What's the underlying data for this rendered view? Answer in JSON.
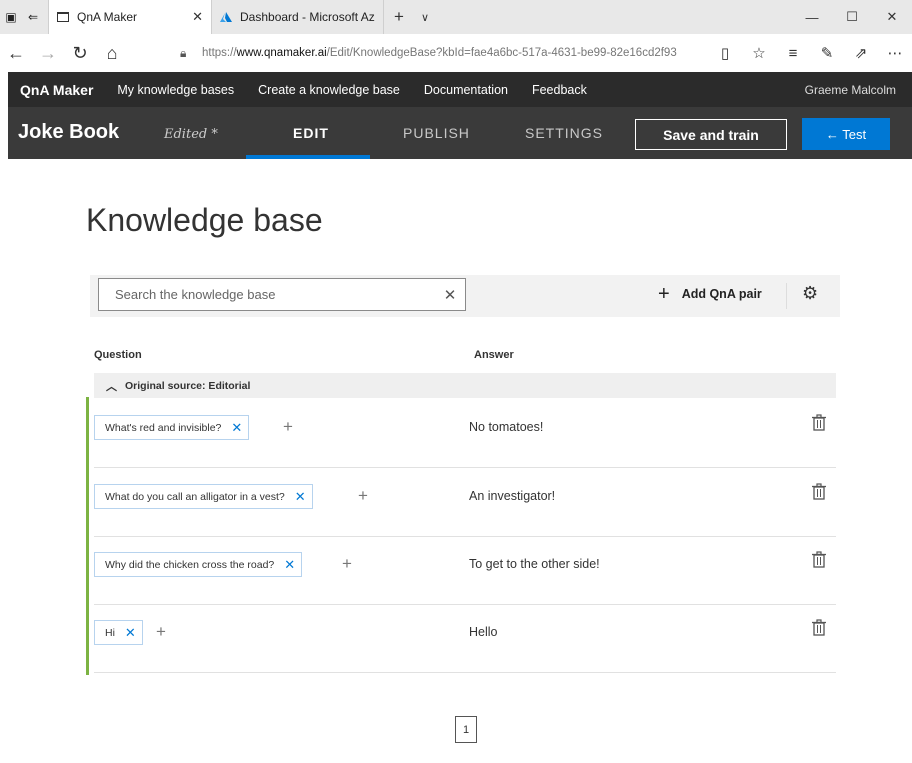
{
  "browser": {
    "tabs": [
      {
        "title": "QnA Maker",
        "close": "✕"
      },
      {
        "title": "Dashboard - Microsoft Azur",
        "close": ""
      }
    ],
    "new_tab": "+",
    "tab_list": "∨",
    "window_controls": [
      "—",
      "☐",
      "✕"
    ],
    "url_prefix": "https://",
    "url_host": "www.qnamaker.ai",
    "url_path": "/Edit/KnowledgeBase?kbId=fae4a6bc-517a-4631-be99-82e16cd2f93"
  },
  "app_nav": {
    "brand": "QnA Maker",
    "links": [
      "My knowledge bases",
      "Create a knowledge base",
      "Documentation",
      "Feedback"
    ],
    "user": "Graeme Malcolm"
  },
  "kb_header": {
    "name": "Joke Book",
    "status": "Edited *",
    "tabs": {
      "edit": "EDIT",
      "publish": "PUBLISH",
      "settings": "SETTINGS"
    },
    "save_label": "Save and train",
    "test_label": "← Test"
  },
  "main": {
    "title": "Knowledge base",
    "search_placeholder": "Search the knowledge base",
    "add_pair_label": "Add QnA pair",
    "col_question": "Question",
    "col_answer": "Answer",
    "source_label": "Original source: Editorial",
    "rows": [
      {
        "question": "What's red and invisible?",
        "answer": "No tomatoes!"
      },
      {
        "question": "What do you call an alligator in a vest?",
        "answer": "An investigator!"
      },
      {
        "question": "Why did the chicken cross the road?",
        "answer": "To get to the other side!"
      },
      {
        "question": "Hi",
        "answer": "Hello"
      }
    ],
    "page_number": "1"
  },
  "colors": {
    "nav_dark": "#2b2b2b",
    "kb_bar": "#3a3a3a",
    "accent_blue": "#0078d4",
    "green_marker": "#7cb342"
  }
}
